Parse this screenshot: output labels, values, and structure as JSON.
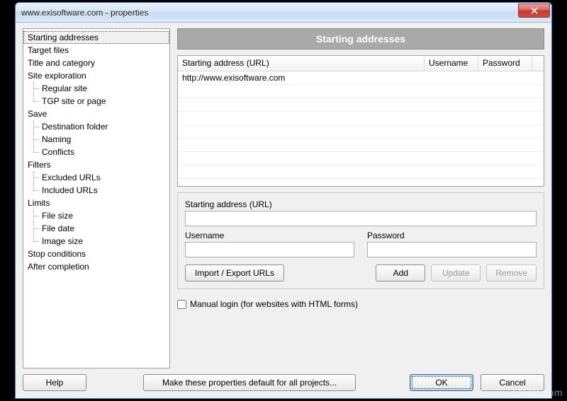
{
  "window": {
    "title": "www.exisoftware.com - properties"
  },
  "sidebar": {
    "items": [
      {
        "label": "Starting addresses",
        "children": [],
        "selected": true
      },
      {
        "label": "Target files",
        "children": []
      },
      {
        "label": "Title and category",
        "children": []
      },
      {
        "label": "Site exploration",
        "children": [
          "Regular site",
          "TGP site or page"
        ]
      },
      {
        "label": "Save",
        "children": [
          "Destination folder",
          "Naming",
          "Conflicts"
        ]
      },
      {
        "label": "Filters",
        "children": [
          "Excluded URLs",
          "Included URLs"
        ]
      },
      {
        "label": "Limits",
        "children": [
          "File size",
          "File date",
          "Image size"
        ]
      },
      {
        "label": "Stop conditions",
        "children": []
      },
      {
        "label": "After completion",
        "children": []
      }
    ]
  },
  "panel": {
    "title": "Starting addresses"
  },
  "table": {
    "columns": [
      "Starting address (URL)",
      "Username",
      "Password"
    ],
    "rows": [
      {
        "url": "http://www.exisoftware.com",
        "username": "",
        "password": ""
      }
    ]
  },
  "form": {
    "url_label": "Starting address (URL)",
    "url_value": "",
    "username_label": "Username",
    "username_value": "",
    "password_label": "Password",
    "password_value": "",
    "import_export": "Import / Export URLs",
    "add": "Add",
    "update": "Update",
    "remove": "Remove"
  },
  "manual_login": {
    "checked": false,
    "label": "Manual login (for websites with HTML forms)"
  },
  "buttons": {
    "help": "Help",
    "make_default": "Make these properties default for all projects...",
    "ok": "OK",
    "cancel": "Cancel"
  },
  "watermark": "LO4D.com"
}
